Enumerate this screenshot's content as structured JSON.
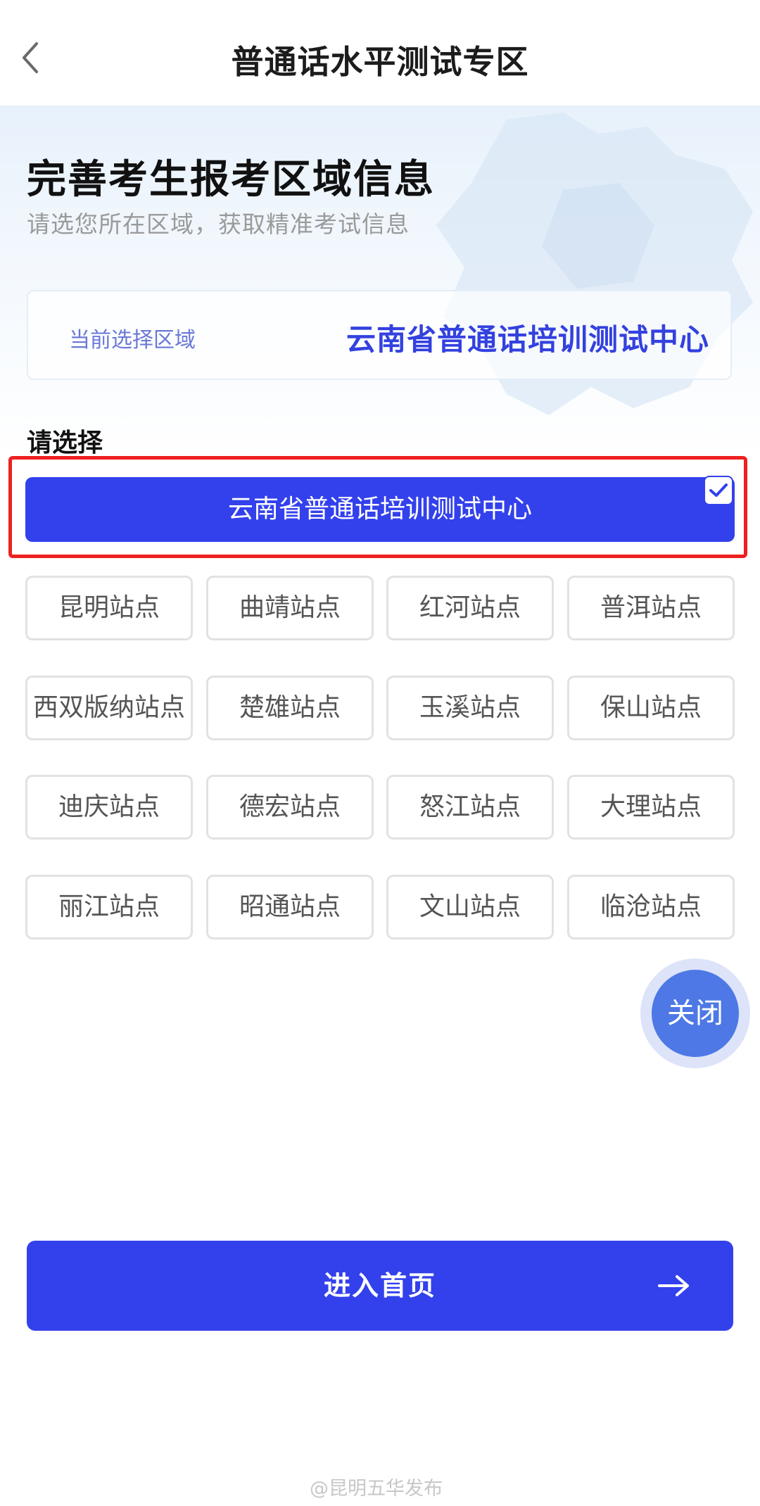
{
  "nav": {
    "title": "普通话水平测试专区"
  },
  "hero": {
    "title": "完善考生报考区域信息",
    "subtitle": "请选您所在区域，获取精准考试信息"
  },
  "current_region": {
    "label": "当前选择区域",
    "value": "云南省普通话培训测试中心"
  },
  "select_heading": "请选择",
  "primary_option": {
    "label": "云南省普通话培训测试中心",
    "selected": true
  },
  "sites": [
    "昆明站点",
    "曲靖站点",
    "红河站点",
    "普洱站点",
    "西双版纳站点",
    "楚雄站点",
    "玉溪站点",
    "保山站点",
    "迪庆站点",
    "德宏站点",
    "怒江站点",
    "大理站点",
    "丽江站点",
    "昭通站点",
    "文山站点",
    "临沧站点"
  ],
  "close_label": "关闭",
  "enter_label": "进入首页",
  "watermark": "@昆明五华发布",
  "colors": {
    "accent": "#3341ec",
    "highlight": "#ee2020",
    "fab": "#4d78e6"
  }
}
